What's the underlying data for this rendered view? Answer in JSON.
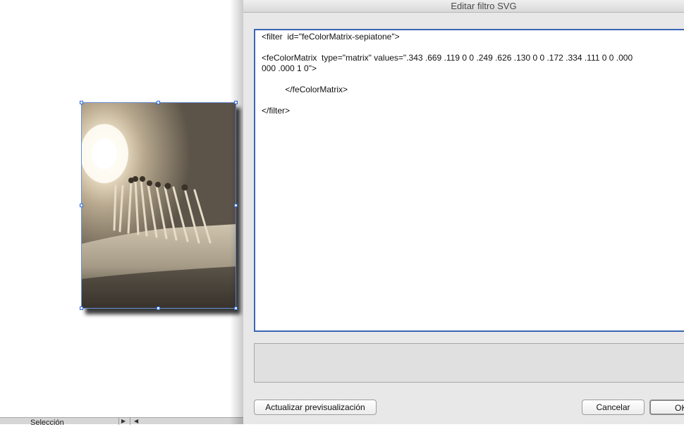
{
  "dialog": {
    "title": "Editar filtro SVG",
    "code_lines": [
      "<filter  id=\"feColorMatrix-sepiatone\">",
      "<feColorMatrix  type=\"matrix\" values=\".343 .669 .119 0 0 .249 .626 .130 0 0 .172 .334 .111 0 0 .000",
      "000 .000 1 0\">",
      "          </feColorMatrix>",
      "</filter>"
    ],
    "buttons": {
      "update_preview": "Actualizar previsualización",
      "cancel": "Cancelar",
      "ok": "OK"
    }
  },
  "statusbar": {
    "tool_label": "Selección"
  },
  "canvas": {
    "image_icon": "sepia-matches-photo"
  },
  "colors": {
    "selection": "#2e6bd6",
    "editor_focus": "#3a66b5"
  }
}
